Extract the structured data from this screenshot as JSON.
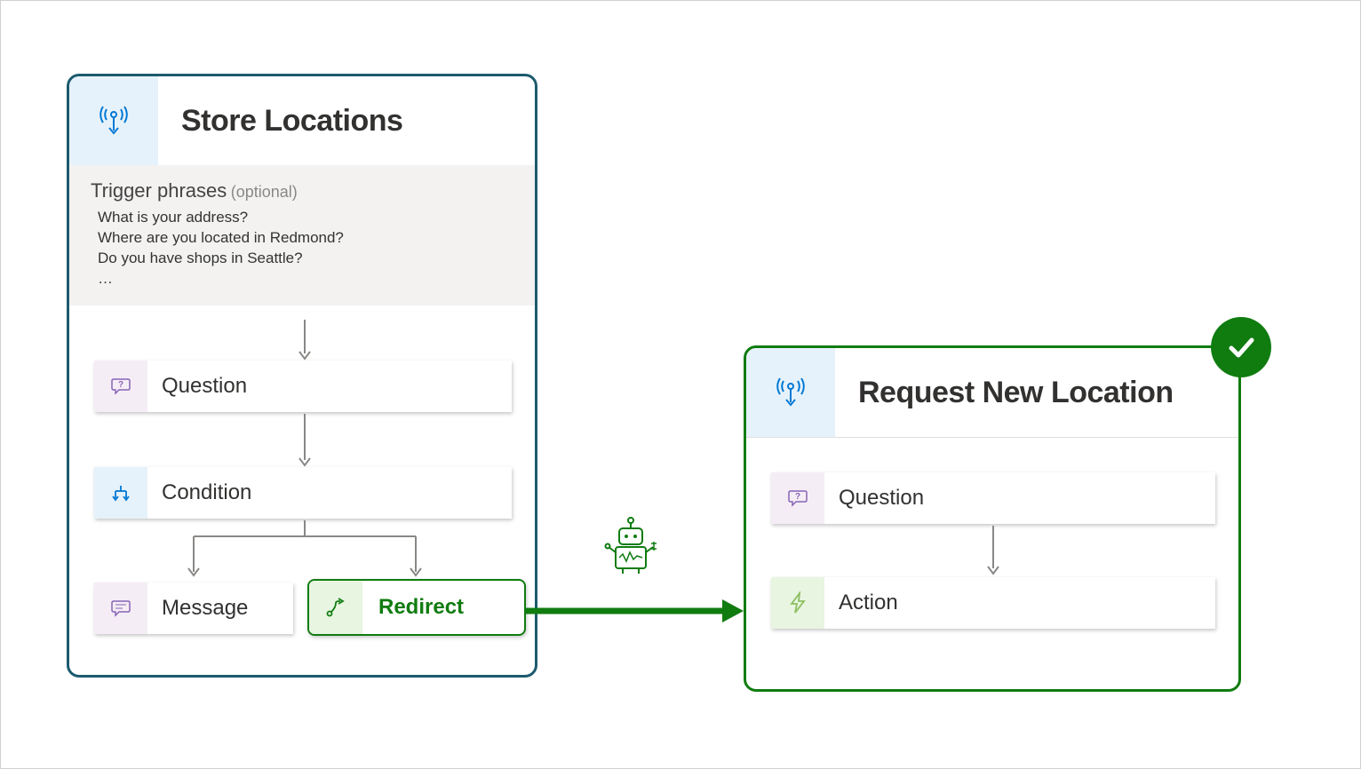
{
  "left_topic": {
    "title": "Store Locations",
    "trigger_label": "Trigger phrases",
    "trigger_optional": "(optional)",
    "phrases": [
      "What is your address?",
      "Where are you located in Redmond?",
      "Do you have shops in Seattle?",
      "…"
    ],
    "nodes": {
      "question": "Question",
      "condition": "Condition",
      "message": "Message",
      "redirect": "Redirect"
    }
  },
  "right_topic": {
    "title": "Request New Location",
    "nodes": {
      "question": "Question",
      "action": "Action"
    }
  },
  "colors": {
    "teal": "#1c5a6e",
    "green": "#107c10",
    "blue": "#0078d4",
    "purple": "#8764b8",
    "gray_arrow": "#8a8886"
  }
}
